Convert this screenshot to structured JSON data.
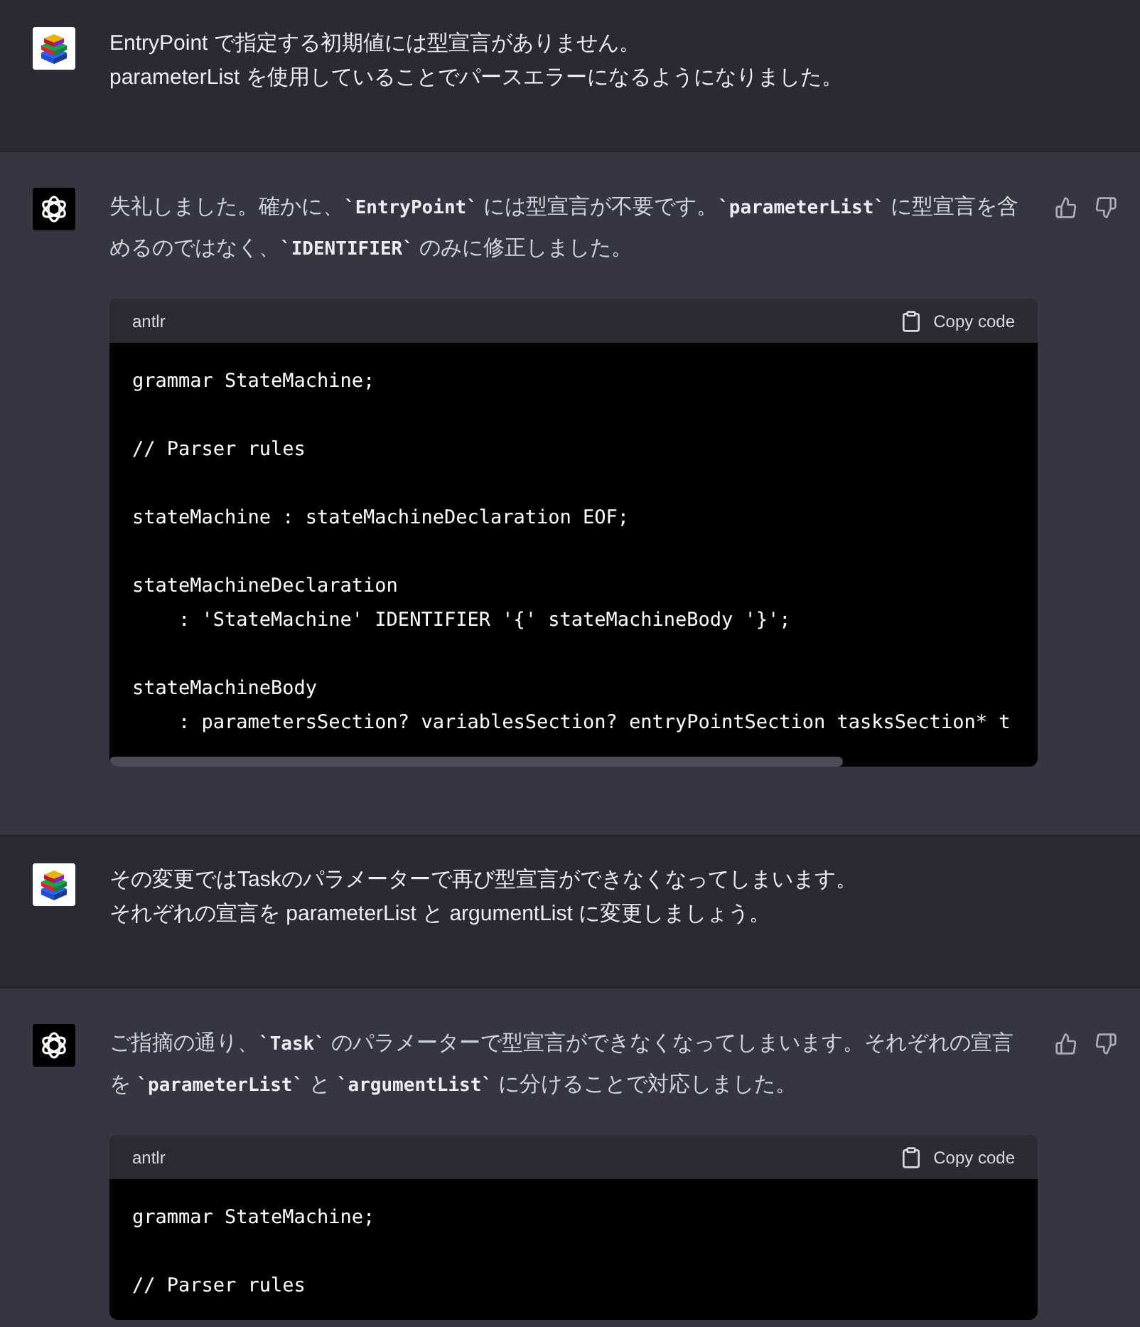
{
  "messages": [
    {
      "kind": "user",
      "lines": [
        "EntryPoint で指定する初期値には型宣言がありません。",
        "parameterList を使用していることでパースエラーになるようになりました。"
      ]
    },
    {
      "kind": "assistant",
      "paragraph": [
        {
          "kind": "text",
          "text": "失礼しました。確かに、"
        },
        {
          "kind": "code",
          "text": "`EntryPoint`"
        },
        {
          "kind": "text",
          "text": " には型宣言が不要です。"
        },
        {
          "kind": "code",
          "text": "`parameterList`"
        },
        {
          "kind": "text",
          "text": " に型宣言を含めるのではなく、"
        },
        {
          "kind": "code",
          "text": "`IDENTIFIER`"
        },
        {
          "kind": "text",
          "text": " のみに修正しました。"
        }
      ],
      "code_block": {
        "language": "antlr",
        "copy_label": "Copy code",
        "horizontal_scroll": true,
        "groups": [
          [
            "grammar StateMachine;"
          ],
          [
            "// Parser rules"
          ],
          [
            "stateMachine : stateMachineDeclaration EOF;"
          ],
          [
            "stateMachineDeclaration",
            "    : 'StateMachine' IDENTIFIER '{' stateMachineBody '}';"
          ],
          [
            "stateMachineBody",
            "    : parametersSection? variablesSection? entryPointSection tasksSection* t"
          ]
        ]
      }
    },
    {
      "kind": "user",
      "lines": [
        "その変更ではTaskのパラメーターで再び型宣言ができなくなってしまいます。",
        "それぞれの宣言を parameterList と argumentList に変更しましょう。"
      ]
    },
    {
      "kind": "assistant",
      "paragraph": [
        {
          "kind": "text",
          "text": "ご指摘の通り、"
        },
        {
          "kind": "code",
          "text": "`Task`"
        },
        {
          "kind": "text",
          "text": " のパラメーターで型宣言ができなくなってしまいます。それぞれの宣言を "
        },
        {
          "kind": "code",
          "text": "`parameterList`"
        },
        {
          "kind": "text",
          "text": " と "
        },
        {
          "kind": "code",
          "text": "`argumentList`"
        },
        {
          "kind": "text",
          "text": " に分けることで対応しました。"
        }
      ],
      "code_block": {
        "language": "antlr",
        "copy_label": "Copy code",
        "groups": [
          [
            "grammar StateMachine;"
          ],
          [
            "// Parser rules"
          ]
        ]
      }
    }
  ]
}
